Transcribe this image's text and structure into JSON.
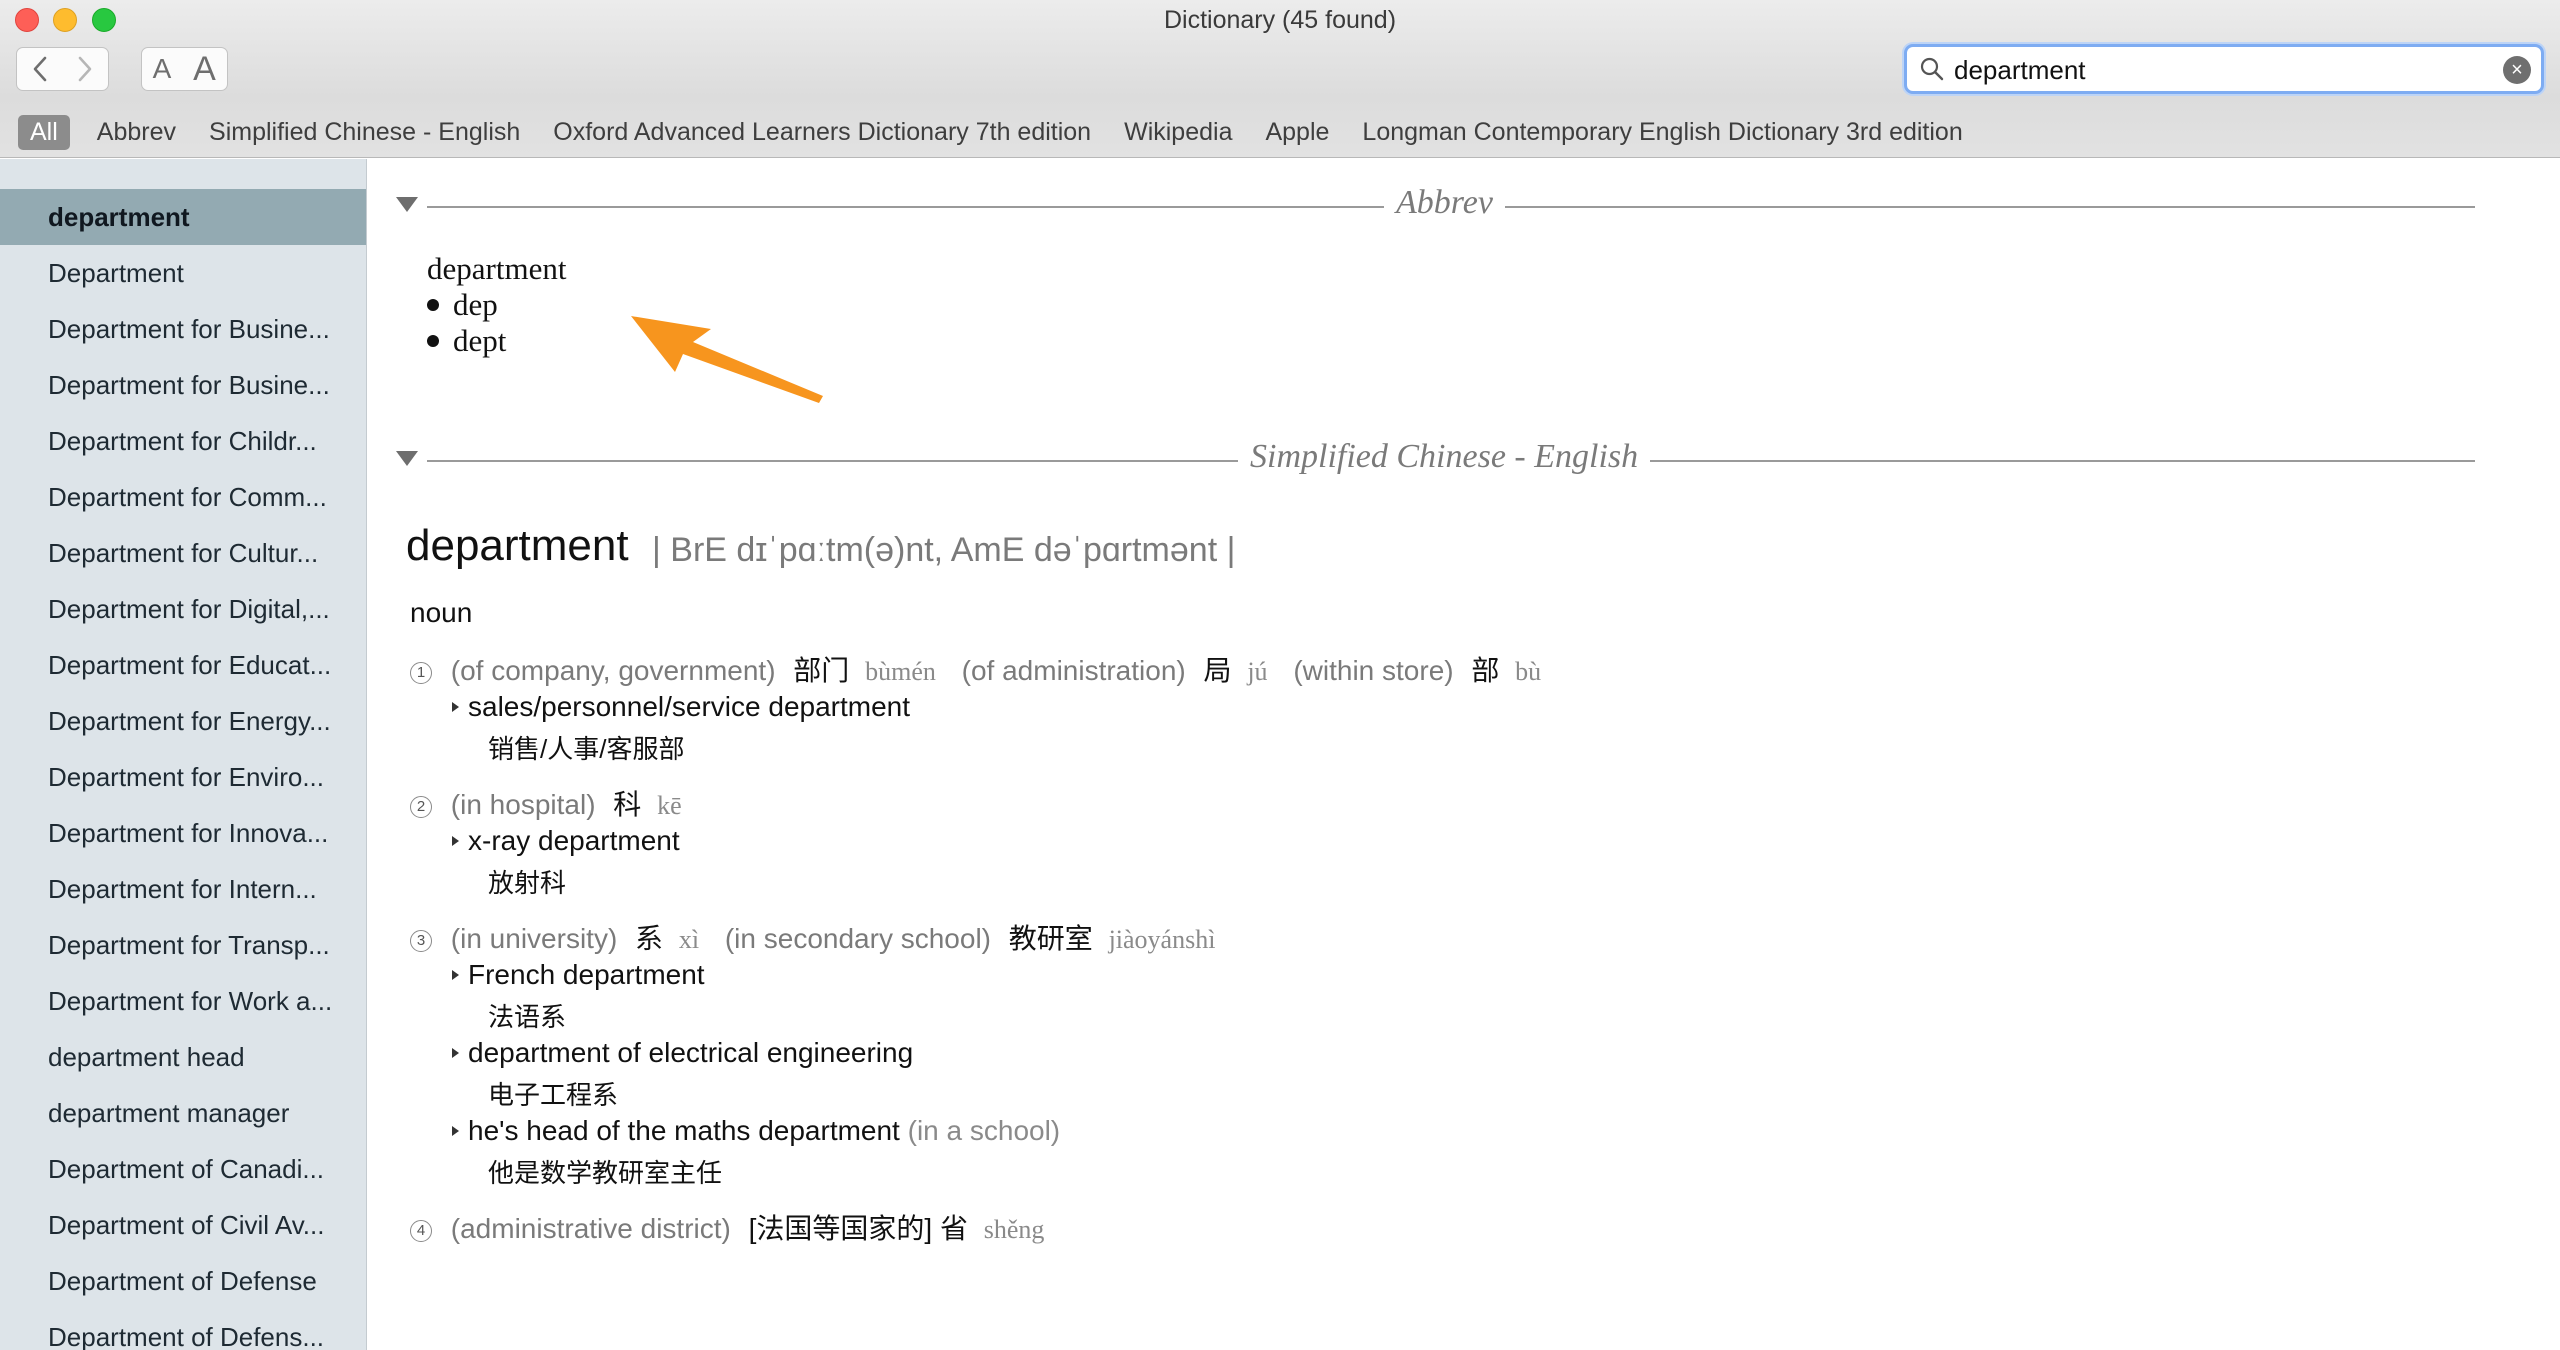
{
  "window": {
    "title": "Dictionary (45 found)"
  },
  "toolbar": {
    "back_label": "‹",
    "forward_label": "›",
    "font_smaller_label": "A",
    "font_larger_label": "A",
    "search_value": "department",
    "clear_label": "×"
  },
  "sources": [
    "All",
    "Abbrev",
    "Simplified Chinese - English",
    "Oxford Advanced Learners Dictionary 7th edition",
    "Wikipedia",
    "Apple",
    "Longman Contemporary English Dictionary 3rd edition"
  ],
  "sidebar": {
    "items": [
      "department",
      "Department",
      "Department for Busine...",
      "Department for Busine...",
      "Department for Childr...",
      "Department for Comm...",
      "Department for Cultur...",
      "Department for Digital,...",
      "Department for Educat...",
      "Department for Energy...",
      "Department for Enviro...",
      "Department for Innova...",
      "Department for Intern...",
      "Department for Transp...",
      "Department for Work a...",
      "department head",
      "department manager",
      "Department of Canadi...",
      "Department of Civil Av...",
      "Department of Defense",
      "Department of Defens..."
    ]
  },
  "abbrev": {
    "section_title": "Abbrev",
    "headword": "department",
    "items": [
      "dep",
      "dept"
    ]
  },
  "chinese": {
    "section_title": "Simplified Chinese - English",
    "headword": "department",
    "pronunciation": "| BrE dɪˈpɑːtm(ə)nt,   AmE dəˈpɑrtmənt |",
    "pos": "noun",
    "senses": [
      {
        "num": "1",
        "parts": [
          {
            "gloss": "(of company, government)",
            "zh": "部门",
            "py": "bùmén"
          },
          {
            "gloss": "(of administration)",
            "zh": "局",
            "py": "jú"
          },
          {
            "gloss": "(within store)",
            "zh": "部",
            "py": "bù"
          }
        ]
      },
      {
        "num": "2",
        "parts": [
          {
            "gloss": "(in hospital)",
            "zh": "科",
            "py": "kē"
          }
        ]
      },
      {
        "num": "3",
        "parts": [
          {
            "gloss": "(in university)",
            "zh": "系",
            "py": "xì"
          },
          {
            "gloss": "(in secondary school)",
            "zh": "教研室",
            "py": "jiàoyánshì"
          }
        ]
      },
      {
        "num": "4",
        "parts": [
          {
            "gloss": "(administrative district)",
            "zh": "[法国等国家的] 省",
            "py": "shěng"
          }
        ]
      }
    ],
    "examples": [
      {
        "en": "sales/personnel/service department",
        "note": "",
        "zh": "销售/人事/客服部"
      },
      {
        "en": "x-ray department",
        "note": "",
        "zh": "放射科"
      },
      {
        "en": "French department",
        "note": "",
        "zh": "法语系"
      },
      {
        "en": "department of electrical engineering",
        "note": "",
        "zh": "电子工程系"
      },
      {
        "en": "he's head of the maths department",
        "note": "(in a school)",
        "zh": "他是数学教研室主任"
      }
    ]
  },
  "colors": {
    "annotation_arrow": "#f7951e",
    "sidebar_selected": "#93aab2",
    "search_focus": "#7eacf2"
  }
}
